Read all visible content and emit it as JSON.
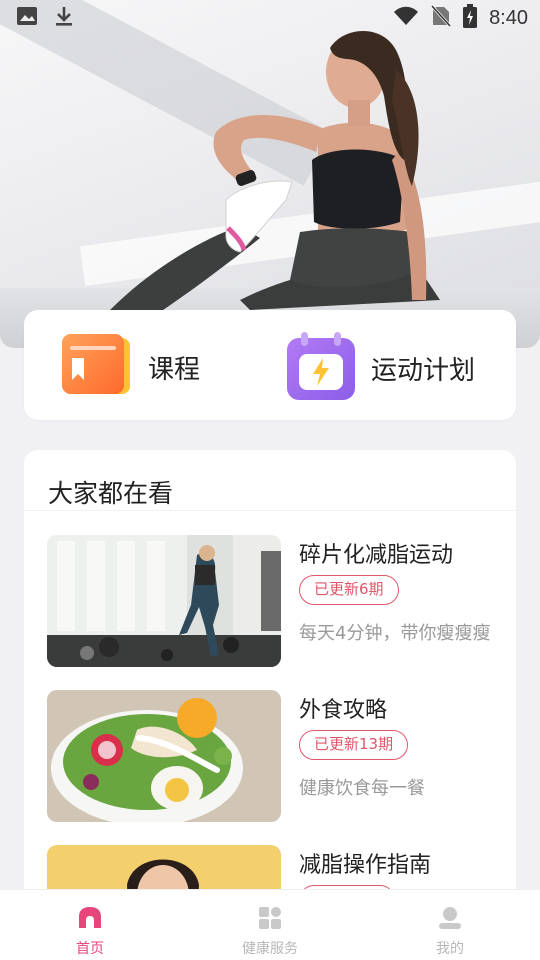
{
  "status_bar": {
    "time": "8:40",
    "left_icons": [
      "image-icon",
      "download-icon"
    ],
    "right_icons": [
      "wifi-icon",
      "no-sim-icon",
      "battery-charging-icon"
    ]
  },
  "hero": {
    "image": "woman-stretching-photo"
  },
  "quick_actions": [
    {
      "label": "课程",
      "icon": "course-folder-icon",
      "color": "#ff7b3a"
    },
    {
      "label": "运动计划",
      "icon": "calendar-bolt-icon",
      "color": "#9a6cf0"
    }
  ],
  "watching": {
    "title": "大家都在看",
    "items": [
      {
        "title": "碎片化减脂运动",
        "badge": "已更新6期",
        "desc": "每天4分钟，带你瘦瘦瘦",
        "image": "gym-workout-photo"
      },
      {
        "title": "外食攻略",
        "badge": "已更新13期",
        "desc": "健康饮食每一餐",
        "image": "salad-bowl-photo"
      },
      {
        "title": "减脂操作指南",
        "badge": "",
        "desc": "",
        "image": "woman-portrait-photo"
      }
    ]
  },
  "bottom_nav": {
    "active_color": "#e8467a",
    "tabs": [
      {
        "label": "首页",
        "icon": "home-icon",
        "active": true
      },
      {
        "label": "健康服务",
        "icon": "grid-icon",
        "active": false
      },
      {
        "label": "我的",
        "icon": "profile-icon",
        "active": false
      }
    ]
  }
}
